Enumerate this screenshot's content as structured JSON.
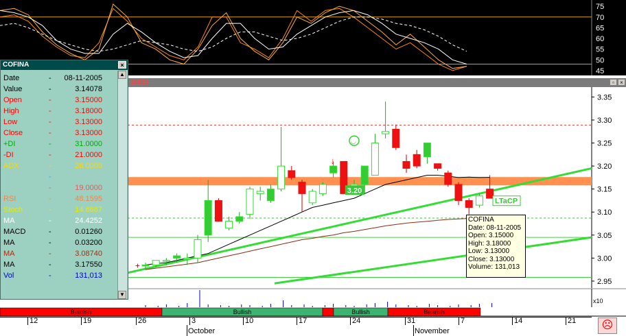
{
  "window": {
    "title": "1000)"
  },
  "stoch_axis": [
    "75",
    "70",
    "65",
    "60",
    "55",
    "50",
    "45"
  ],
  "price_axis": [
    "3.35",
    "3.30",
    "3.25",
    "3.20",
    "3.15",
    "3.10",
    "3.05",
    "3.00",
    "2.95"
  ],
  "candle_label": "3.20",
  "trendline_label": "LTaCP",
  "volume_multiplier": "x10",
  "info_panel": {
    "title": "COFINA",
    "rows": [
      {
        "key": "Date",
        "value": "08-11-2005",
        "color": "#000000"
      },
      {
        "key": "Value",
        "value": "3.14078",
        "color": "#000000"
      },
      {
        "key": "Open",
        "value": "3.15000",
        "color": "#ff0000"
      },
      {
        "key": "High",
        "value": "3.18000",
        "color": "#ff0000"
      },
      {
        "key": "Low",
        "value": "3.13000",
        "color": "#ff0000"
      },
      {
        "key": "Close",
        "value": "3.13000",
        "color": "#ff0000"
      },
      {
        "key": "+DI",
        "value": "31.0000",
        "color": "#00aa00"
      },
      {
        "key": "-DI",
        "value": "21.0000",
        "color": "#ff0000"
      },
      {
        "key": "ADX",
        "value": "26.0000",
        "color": "#ffd700"
      },
      {
        "key": "",
        "value": "",
        "color": "#00c0ff"
      },
      {
        "key": "",
        "value": "19.0000",
        "color": "#d86060"
      },
      {
        "key": "RSI",
        "value": "48.1595",
        "color": "#ff8040"
      },
      {
        "key": "Stoch",
        "value": "14.6667",
        "color": "#e8e800"
      },
      {
        "key": "MA",
        "value": "24.4252",
        "color": "#ffffff"
      },
      {
        "key": "MACD",
        "value": "0.01260",
        "color": "#000000"
      },
      {
        "key": "MA",
        "value": "0.03200",
        "color": "#000000"
      },
      {
        "key": "MA",
        "value": "3.08740",
        "color": "#a03010"
      },
      {
        "key": "MA",
        "value": "3.17550",
        "color": "#000000"
      },
      {
        "key": "Vol",
        "value": "131,013",
        "color": "#0000cc"
      }
    ]
  },
  "tooltip": {
    "lines": [
      "COFINA",
      "Date: 08-11-2005",
      "Open: 3.15000",
      "High: 3.18000",
      "Low: 3.13000",
      "Close: 3.13000",
      "Volume: 131,013"
    ]
  },
  "trend_bands": [
    {
      "label": "Bearish",
      "color": "#ff0000"
    },
    {
      "label": "Bullish",
      "color": "#3cb371"
    },
    {
      "label": "",
      "color": "#ff0000"
    },
    {
      "label": "Bullish",
      "color": "#3cb371"
    },
    {
      "label": "Bearish",
      "color": "#ff0000"
    }
  ],
  "timeline": {
    "days": [
      "12",
      "19",
      "26",
      "3",
      "10",
      "17",
      "24",
      "31",
      "7",
      "14",
      "21"
    ],
    "months": [
      "October",
      "November"
    ]
  },
  "chart_data": {
    "type": "candlestick",
    "title": "COFINA",
    "ylim": [
      2.935,
      3.37
    ],
    "candles": [
      {
        "o": 2.985,
        "h": 2.99,
        "l": 2.975,
        "c": 2.985
      },
      {
        "o": 2.985,
        "h": 2.995,
        "l": 2.98,
        "c": 2.995
      },
      {
        "o": 2.995,
        "h": 3.0,
        "l": 2.985,
        "c": 2.995
      },
      {
        "o": 3.0,
        "h": 3.01,
        "l": 2.99,
        "c": 3.005
      },
      {
        "o": 3.0,
        "h": 3.01,
        "l": 2.985,
        "c": 3.0
      },
      {
        "o": 3.0,
        "h": 3.05,
        "l": 2.99,
        "c": 3.04
      },
      {
        "o": 3.05,
        "h": 3.17,
        "l": 3.035,
        "c": 3.125
      },
      {
        "o": 3.125,
        "h": 3.13,
        "l": 3.08,
        "c": 3.08
      },
      {
        "o": 3.065,
        "h": 3.09,
        "l": 3.06,
        "c": 3.08
      },
      {
        "o": 3.08,
        "h": 3.1,
        "l": 3.075,
        "c": 3.09
      },
      {
        "o": 3.095,
        "h": 3.155,
        "l": 3.085,
        "c": 3.15
      },
      {
        "o": 3.14,
        "h": 3.155,
        "l": 3.125,
        "c": 3.145
      },
      {
        "o": 3.125,
        "h": 3.16,
        "l": 3.12,
        "c": 3.15
      },
      {
        "o": 3.15,
        "h": 3.285,
        "l": 3.145,
        "c": 3.2
      },
      {
        "o": 3.19,
        "h": 3.2,
        "l": 3.17,
        "c": 3.175
      },
      {
        "o": 3.165,
        "h": 3.17,
        "l": 3.1,
        "c": 3.14
      },
      {
        "o": 3.12,
        "h": 3.15,
        "l": 3.115,
        "c": 3.145
      },
      {
        "o": 3.14,
        "h": 3.165,
        "l": 3.135,
        "c": 3.16
      },
      {
        "o": 3.185,
        "h": 3.21,
        "l": 3.175,
        "c": 3.2
      },
      {
        "o": 3.21,
        "h": 3.21,
        "l": 3.14,
        "c": 3.14
      },
      {
        "o": 3.15,
        "h": 3.17,
        "l": 3.145,
        "c": 3.16
      },
      {
        "o": 3.16,
        "h": 3.2,
        "l": 3.14,
        "c": 3.2
      },
      {
        "o": 3.18,
        "h": 3.27,
        "l": 3.18,
        "c": 3.25
      },
      {
        "o": 3.27,
        "h": 3.34,
        "l": 3.26,
        "c": 3.275
      },
      {
        "o": 3.28,
        "h": 3.29,
        "l": 3.235,
        "c": 3.24
      },
      {
        "o": 3.21,
        "h": 3.225,
        "l": 3.185,
        "c": 3.195
      },
      {
        "o": 3.225,
        "h": 3.235,
        "l": 3.195,
        "c": 3.2
      },
      {
        "o": 3.22,
        "h": 3.25,
        "l": 3.205,
        "c": 3.25
      },
      {
        "o": 3.205,
        "h": 3.205,
        "l": 3.19,
        "c": 3.195
      },
      {
        "o": 3.185,
        "h": 3.19,
        "l": 3.155,
        "c": 3.16
      },
      {
        "o": 3.16,
        "h": 3.165,
        "l": 3.115,
        "c": 3.125
      },
      {
        "o": 3.125,
        "h": 3.13,
        "l": 3.095,
        "c": 3.11
      },
      {
        "o": 3.115,
        "h": 3.14,
        "l": 3.11,
        "c": 3.135
      },
      {
        "o": 3.15,
        "h": 3.18,
        "l": 3.13,
        "c": 3.13
      }
    ],
    "stochastic": {
      "fast": [
        73,
        74,
        71,
        63,
        57,
        53,
        50,
        55,
        76,
        70,
        58,
        55,
        50,
        48,
        55,
        66,
        72,
        60,
        54,
        50,
        58,
        70,
        67,
        72,
        75,
        73,
        68,
        63,
        57,
        62,
        56,
        50,
        46,
        47
      ],
      "slow": [
        73,
        72,
        70,
        66,
        59,
        55,
        53,
        53,
        62,
        67,
        63,
        58,
        54,
        51,
        52,
        60,
        67,
        67,
        60,
        55,
        56,
        62,
        66,
        70,
        72,
        73,
        71,
        67,
        62,
        60,
        58,
        55,
        50,
        48
      ],
      "signal": [
        66,
        67,
        65,
        62,
        59,
        57,
        55,
        54,
        55,
        57,
        59,
        58,
        57,
        55,
        54,
        56,
        60,
        63,
        63,
        61,
        59,
        60,
        62,
        65,
        68,
        70,
        70,
        69,
        67,
        66,
        64,
        61,
        57,
        54
      ],
      "orange": [
        70,
        71,
        68,
        61,
        56,
        52,
        51,
        58,
        74,
        68,
        60,
        56,
        52,
        50,
        56,
        70,
        70,
        58,
        55,
        51,
        60,
        73,
        68,
        73,
        74,
        70,
        65,
        60,
        55,
        58,
        53,
        48,
        45,
        47
      ]
    },
    "stoch_ylim": [
      44,
      76
    ]
  }
}
